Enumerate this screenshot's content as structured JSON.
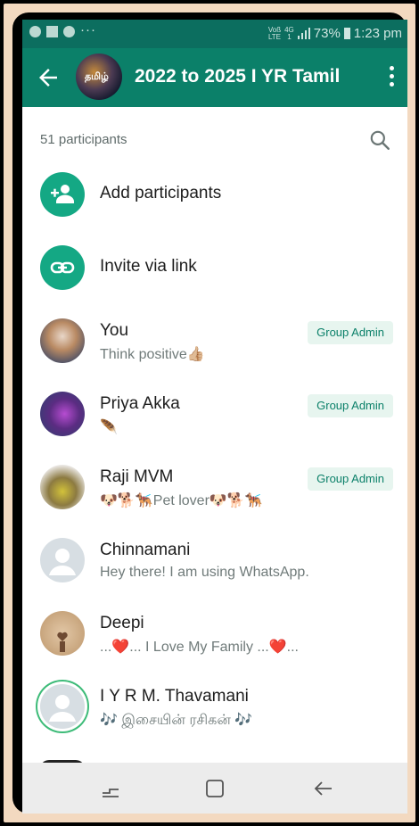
{
  "status_bar": {
    "carrier_top": "Voß",
    "carrier_bottom": "LTE",
    "network_top": "4G",
    "network_bottom": "1",
    "battery_percent": "73%",
    "time": "1:23 pm"
  },
  "header": {
    "group_name": "2022 to 2025 I YR Tamil",
    "avatar_text": "தமிழ்"
  },
  "participants": {
    "count_label": "51 participants"
  },
  "actions": {
    "add_label": "Add participants",
    "invite_label": "Invite via link"
  },
  "members": [
    {
      "name": "You",
      "status": "Think positive👍🏼",
      "badge": "Group Admin"
    },
    {
      "name": "Priya Akka",
      "status": "🪶",
      "badge": "Group Admin"
    },
    {
      "name": "Raji MVM",
      "status": "🐶🐕🐕‍🦺Pet lover🐶🐕🐕‍🦺",
      "badge": "Group Admin"
    },
    {
      "name": "Chinnamani",
      "status": "Hey there! I am using WhatsApp."
    },
    {
      "name": "Deepi",
      "status": "...❤️... I Love My Family ...❤️..."
    },
    {
      "name": "I Y R M. Thavamani",
      "status": "🎶 இசையின் ரசிகன் 🎶"
    }
  ],
  "colors": {
    "header_bg": "#0b8069",
    "accent": "#14a884",
    "badge_bg": "#e7f5ef",
    "badge_text": "#0b8069"
  }
}
